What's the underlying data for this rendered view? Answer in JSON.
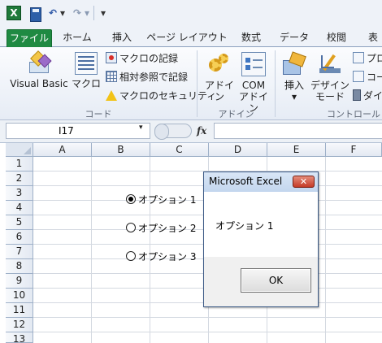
{
  "quick_access": {
    "app_icon": "excel-icon",
    "app_letter": "X",
    "save_icon": "save-icon",
    "undo_icon": "undo-icon",
    "undo_glyph": "↶",
    "redo_icon": "redo-icon",
    "redo_glyph": "↷",
    "dropdown_glyph": "▾",
    "customize_glyph": "▾"
  },
  "tabs": [
    {
      "label": "ファイル",
      "active": false
    },
    {
      "label": "ホーム"
    },
    {
      "label": "挿入"
    },
    {
      "label": "ページ レイアウト"
    },
    {
      "label": "数式"
    },
    {
      "label": "データ"
    },
    {
      "label": "校閲"
    },
    {
      "label": "表"
    }
  ],
  "ribbon": {
    "code_group": {
      "label": "コード",
      "visual_basic": "Visual Basic",
      "macro": "マクロ",
      "record_macro": "マクロの記録",
      "relative_ref": "相対参照で記録",
      "macro_security": "マクロのセキュリティ"
    },
    "addin_group": {
      "label": "アドイン",
      "addin": "アドイン",
      "com_addin_line1": "COM",
      "com_addin_line2": "アドイン"
    },
    "controls_group": {
      "label": "コントロール",
      "insert": "挿入",
      "insert_dropdown": "▾",
      "design_line1": "デザイン",
      "design_line2": "モード",
      "properties": "プロ",
      "view_code": "コー",
      "dialog": "ダイ"
    }
  },
  "formula_bar": {
    "name_box": "I17",
    "name_box_dropdown": "▾",
    "fx": "fx",
    "formula": ""
  },
  "sheet": {
    "columns": [
      "A",
      "B",
      "C",
      "D",
      "E",
      "F"
    ],
    "rows": [
      "1",
      "2",
      "3",
      "4",
      "5",
      "6",
      "7",
      "8",
      "9",
      "10",
      "11",
      "12",
      "13"
    ]
  },
  "option_buttons": [
    {
      "label": "オプション 1",
      "selected": true
    },
    {
      "label": "オプション 2",
      "selected": false
    },
    {
      "label": "オプション 3",
      "selected": false
    }
  ],
  "message_box": {
    "title": "Microsoft Excel",
    "close_glyph": "✕",
    "message": "オプション 1",
    "ok_label": "OK"
  },
  "colors": {
    "file_tab": "#1f8a42",
    "close_button": "#c43a26",
    "dialog_border": "#3c5a86"
  }
}
